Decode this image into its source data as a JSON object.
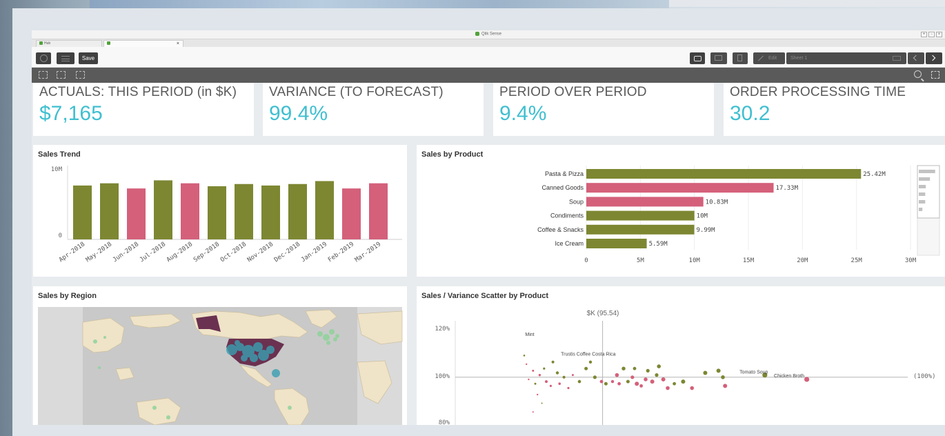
{
  "app": {
    "window_title": "Qlik Sense",
    "tabs": [
      {
        "label": "Hub"
      },
      {
        "label": ""
      }
    ],
    "tab_close": "×"
  },
  "toolbar": {
    "save_label": "Save",
    "edit_label": "Edit",
    "sheet_name": "Sheet 1"
  },
  "kpis": [
    {
      "title": "ACTUALS: THIS PERIOD (in $K)",
      "value": "$7,165"
    },
    {
      "title": "VARIANCE (TO FORECAST)",
      "value": "99.4%"
    },
    {
      "title": "PERIOD OVER PERIOD",
      "value": "9.4%"
    },
    {
      "title": "ORDER PROCESSING TIME",
      "value": "30.2"
    }
  ],
  "colors": {
    "olive": "#7d8732",
    "pink": "#d4607a",
    "teal": "#3fbfd0",
    "map_highlight": "#6b3150",
    "map_land": "#efe3c8",
    "map_water": "#c9c9c9"
  },
  "sales_by_region": {
    "title": "Sales by Region"
  },
  "chart_data": [
    {
      "type": "bar",
      "title": "Sales Trend",
      "categories": [
        "Apr-2018",
        "May-2018",
        "Jun-2018",
        "Jul-2018",
        "Aug-2018",
        "Sep-2018",
        "Oct-2018",
        "Nov-2018",
        "Dec-2018",
        "Jan-2019",
        "Feb-2019",
        "Mar-2019"
      ],
      "values": [
        7.3,
        7.6,
        6.9,
        8.0,
        7.6,
        7.2,
        7.5,
        7.3,
        7.5,
        7.9,
        6.9,
        7.6
      ],
      "colors": [
        "olive",
        "olive",
        "pink",
        "olive",
        "pink",
        "olive",
        "olive",
        "olive",
        "olive",
        "olive",
        "pink",
        "pink"
      ],
      "y_ticks": [
        "0",
        "10M"
      ],
      "ylim": [
        0,
        10
      ]
    },
    {
      "type": "bar",
      "orientation": "horizontal",
      "title": "Sales by Product",
      "categories": [
        "Pasta & Pizza",
        "Canned Goods",
        "Soup",
        "Condiments",
        "Coffee & Snacks",
        "Ice Cream"
      ],
      "values": [
        25.42,
        17.33,
        10.83,
        10,
        9.99,
        5.59
      ],
      "data_labels": [
        "25.42M",
        "17.33M",
        "10.83M",
        "10M",
        "9.99M",
        "5.59M"
      ],
      "colors": [
        "olive",
        "pink",
        "pink",
        "olive",
        "olive",
        "olive"
      ],
      "x_ticks": [
        "0",
        "5M",
        "10M",
        "15M",
        "20M",
        "25M",
        "30M"
      ],
      "xlim": [
        0,
        30
      ]
    },
    {
      "type": "scatter",
      "title": "Sales / Variance Scatter by Product",
      "reference_x_label": "$K (95.54)",
      "reference_y_label": "(100%)",
      "y_ticks": [
        "120%",
        "100%",
        "80%"
      ],
      "ylim": [
        78,
        126
      ],
      "xlim": [
        0,
        400
      ],
      "point_labels": [
        {
          "label": "Mint",
          "x": 65,
          "y": 118
        },
        {
          "label": "Trustis Coffee Costa Rica",
          "x": 118,
          "y": 109
        },
        {
          "label": "Tomato Soup",
          "x": 268,
          "y": 100.7
        },
        {
          "label": "Chicken Broth",
          "x": 300,
          "y": 99
        }
      ],
      "points": [
        {
          "x": 60,
          "y": 110,
          "c": "olive",
          "r": 1.3
        },
        {
          "x": 62,
          "y": 106,
          "c": "pink",
          "r": 1.2
        },
        {
          "x": 68,
          "y": 103,
          "c": "pink",
          "r": 1.5
        },
        {
          "x": 64,
          "y": 99,
          "c": "pink",
          "r": 1.2
        },
        {
          "x": 70,
          "y": 97,
          "c": "olive",
          "r": 1.5
        },
        {
          "x": 74,
          "y": 101,
          "c": "pink",
          "r": 1.7
        },
        {
          "x": 78,
          "y": 104,
          "c": "olive",
          "r": 1.6
        },
        {
          "x": 80,
          "y": 98,
          "c": "pink",
          "r": 2.0
        },
        {
          "x": 84,
          "y": 96,
          "c": "pink",
          "r": 1.6
        },
        {
          "x": 72,
          "y": 92,
          "c": "pink",
          "r": 1.2
        },
        {
          "x": 76,
          "y": 88,
          "c": "olive",
          "r": 1.0
        },
        {
          "x": 68,
          "y": 84,
          "c": "pink",
          "r": 1.0
        },
        {
          "x": 86,
          "y": 107,
          "c": "olive",
          "r": 2.0
        },
        {
          "x": 90,
          "y": 102,
          "c": "olive",
          "r": 2.2
        },
        {
          "x": 92,
          "y": 97,
          "c": "pink",
          "r": 1.8
        },
        {
          "x": 96,
          "y": 100,
          "c": "olive",
          "r": 2.0
        },
        {
          "x": 100,
          "y": 95,
          "c": "pink",
          "r": 1.6
        },
        {
          "x": 104,
          "y": 101,
          "c": "pink",
          "r": 1.5
        },
        {
          "x": 110,
          "y": 98,
          "c": "olive",
          "r": 2.3
        },
        {
          "x": 116,
          "y": 104,
          "c": "olive",
          "r": 2.5
        },
        {
          "x": 120,
          "y": 107,
          "c": "olive",
          "r": 2.2
        },
        {
          "x": 124,
          "y": 100,
          "c": "olive",
          "r": 2.6
        },
        {
          "x": 130,
          "y": 98,
          "c": "pink",
          "r": 2.4
        },
        {
          "x": 134,
          "y": 97,
          "c": "olive",
          "r": 2.5
        },
        {
          "x": 140,
          "y": 98,
          "c": "pink",
          "r": 2.2
        },
        {
          "x": 144,
          "y": 101,
          "c": "pink",
          "r": 2.8
        },
        {
          "x": 146,
          "y": 97,
          "c": "pink",
          "r": 2.4
        },
        {
          "x": 150,
          "y": 104,
          "c": "olive",
          "r": 2.7
        },
        {
          "x": 154,
          "y": 98,
          "c": "olive",
          "r": 2.5
        },
        {
          "x": 158,
          "y": 100,
          "c": "pink",
          "r": 2.6
        },
        {
          "x": 160,
          "y": 104,
          "c": "olive",
          "r": 2.4
        },
        {
          "x": 162,
          "y": 97,
          "c": "pink",
          "r": 3.0
        },
        {
          "x": 166,
          "y": 96,
          "c": "pink",
          "r": 2.4
        },
        {
          "x": 170,
          "y": 99,
          "c": "pink",
          "r": 2.8
        },
        {
          "x": 172,
          "y": 103,
          "c": "olive",
          "r": 2.6
        },
        {
          "x": 176,
          "y": 98,
          "c": "pink",
          "r": 3.0
        },
        {
          "x": 180,
          "y": 101,
          "c": "olive",
          "r": 2.6
        },
        {
          "x": 182,
          "y": 105,
          "c": "olive",
          "r": 2.8
        },
        {
          "x": 186,
          "y": 99,
          "c": "pink",
          "r": 3.0
        },
        {
          "x": 190,
          "y": 95,
          "c": "pink",
          "r": 2.8
        },
        {
          "x": 196,
          "y": 97,
          "c": "olive",
          "r": 2.4
        },
        {
          "x": 204,
          "y": 98,
          "c": "olive",
          "r": 3.0
        },
        {
          "x": 212,
          "y": 95,
          "c": "pink",
          "r": 2.8
        },
        {
          "x": 224,
          "y": 102,
          "c": "olive",
          "r": 3.0
        },
        {
          "x": 236,
          "y": 103,
          "c": "olive",
          "r": 3.0
        },
        {
          "x": 240,
          "y": 100,
          "c": "olive",
          "r": 2.8
        },
        {
          "x": 242,
          "y": 96,
          "c": "pink",
          "r": 3.0
        },
        {
          "x": 278,
          "y": 101,
          "c": "olive",
          "r": 3.6
        },
        {
          "x": 316,
          "y": 99,
          "c": "pink",
          "r": 3.6
        }
      ]
    }
  ]
}
